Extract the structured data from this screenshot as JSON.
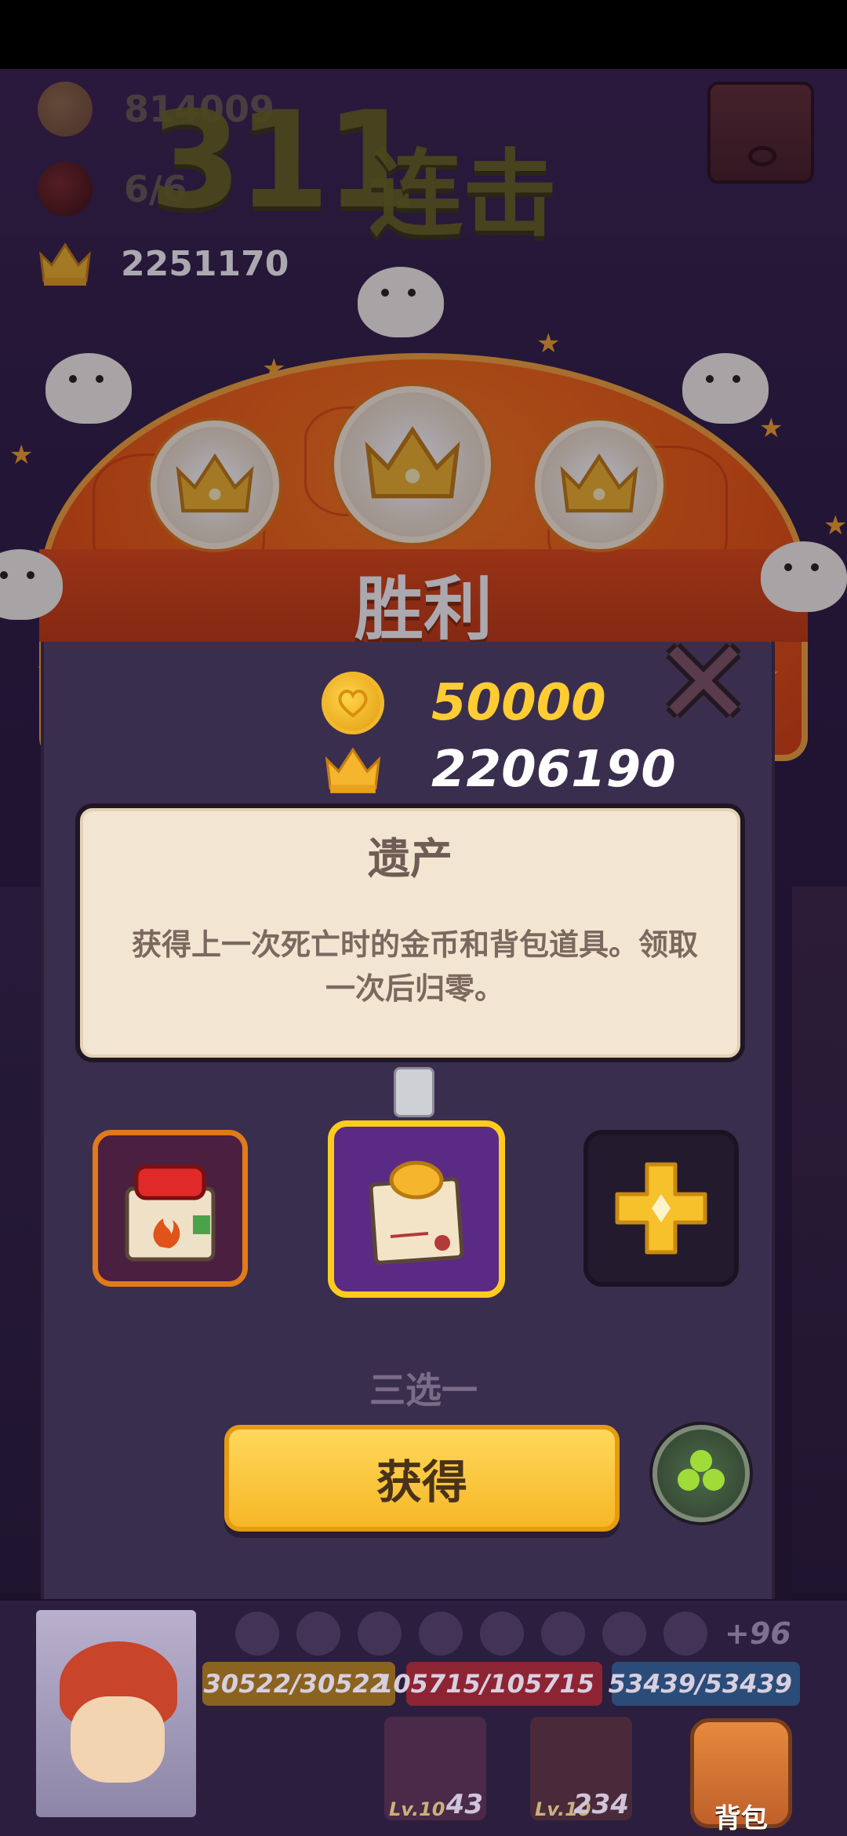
{
  "top_resources": {
    "coins": "814009",
    "lives": "6/6",
    "crowns": "2251170"
  },
  "combo": {
    "number": "311",
    "label": "连击"
  },
  "victory": {
    "banner": "胜利"
  },
  "rewards": {
    "coins": "50000",
    "crowns": "2206190",
    "coin_color": "#ffcc33",
    "crown_color": "#ffffff"
  },
  "card": {
    "title": "遗产",
    "description": "获得上一次死亡时的金币和背包道具。领取一次后归零。"
  },
  "options": {
    "hint": "三选一",
    "items": [
      {
        "icon": "fire-box-icon"
      },
      {
        "icon": "scroll-coin-icon",
        "selected": true
      },
      {
        "icon": "gold-cross-icon"
      }
    ]
  },
  "buttons": {
    "get_label": "获得",
    "clover_icon": "clover-icon",
    "close_icon": "close-icon"
  },
  "hud": {
    "extra_buffs": "+96",
    "shield": "30522/30522",
    "hp": "105715/105715",
    "mana": "53439/53439",
    "slots": [
      {
        "level": "Lv.10",
        "count": "43"
      },
      {
        "level": "Lv.10",
        "count": "234"
      }
    ],
    "bag_label": "背包"
  }
}
